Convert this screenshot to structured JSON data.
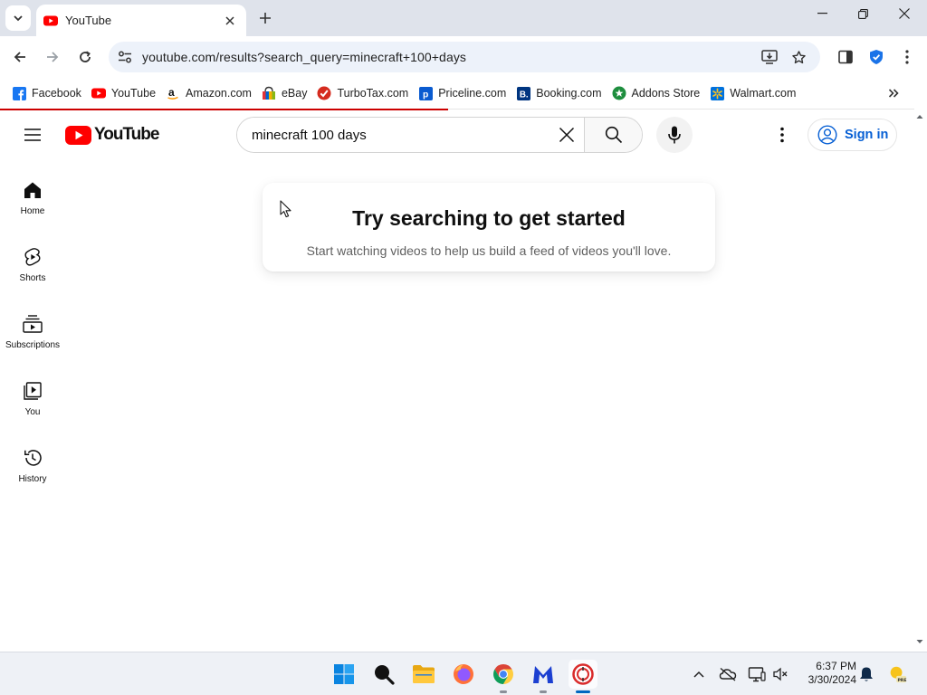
{
  "browser": {
    "tab": {
      "title": "YouTube"
    },
    "url": "youtube.com/results?search_query=minecraft+100+days",
    "bookmarks": [
      {
        "label": "Facebook",
        "icon": "facebook-icon"
      },
      {
        "label": "YouTube",
        "icon": "youtube-icon"
      },
      {
        "label": "Amazon.com",
        "icon": "amazon-icon"
      },
      {
        "label": "eBay",
        "icon": "ebay-icon"
      },
      {
        "label": "TurboTax.com",
        "icon": "turbotax-icon"
      },
      {
        "label": "Priceline.com",
        "icon": "priceline-icon"
      },
      {
        "label": "Booking.com",
        "icon": "booking-icon"
      },
      {
        "label": "Addons Store",
        "icon": "addons-store-icon"
      },
      {
        "label": "Walmart.com",
        "icon": "walmart-icon"
      }
    ],
    "load_progress": 0.49,
    "accent": "#cc0000"
  },
  "youtube": {
    "logo_text": "YouTube",
    "search": {
      "value": "minecraft 100 days"
    },
    "signin_label": "Sign in",
    "guide": [
      {
        "label": "Home",
        "icon": "home-icon"
      },
      {
        "label": "Shorts",
        "icon": "shorts-icon"
      },
      {
        "label": "Subscriptions",
        "icon": "subscriptions-icon"
      },
      {
        "label": "You",
        "icon": "you-icon"
      },
      {
        "label": "History",
        "icon": "history-icon"
      }
    ],
    "promo": {
      "title": "Try searching to get started",
      "body": "Start watching videos to help us build a feed of videos you'll love."
    },
    "colors": {
      "brand_red": "#ff0000",
      "link_blue": "#065fd4"
    }
  },
  "taskbar": {
    "time": "6:37 PM",
    "date": "3/30/2024",
    "apps": [
      "start-icon",
      "search-icon",
      "file-explorer-icon",
      "firefox-icon",
      "chrome-icon",
      "malwarebytes-icon",
      "active-app-icon"
    ],
    "tray": [
      "chevron-up-icon",
      "cloud-off-icon",
      "display-icon",
      "speaker-icon",
      "notification-bell-icon",
      "weather-icon"
    ]
  }
}
